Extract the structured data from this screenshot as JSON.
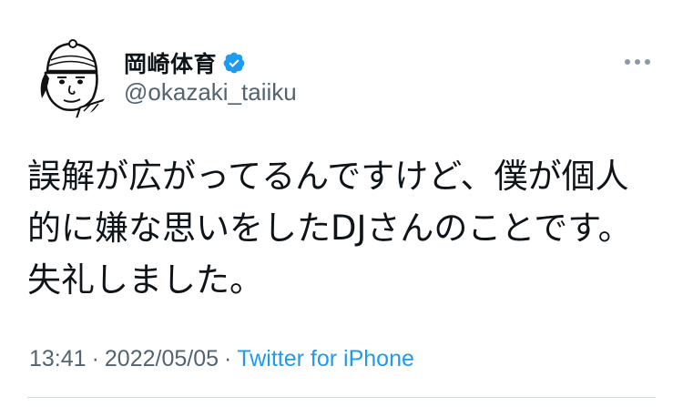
{
  "user": {
    "display_name": "岡崎体育",
    "handle": "@okazaki_taiiku",
    "verified": true,
    "avatar_icon": "profile-avatar-illustration"
  },
  "more_menu": {
    "icon": "more-horizontal-icon"
  },
  "tweet": {
    "text": "誤解が広がってるんですけど、僕が個人的に嫌な思いをしたDJさんのことです。失礼しました。",
    "time": "13:41",
    "separator": "·",
    "date": "2022/05/05",
    "source": "Twitter for iPhone"
  },
  "colors": {
    "text_primary": "#0f1419",
    "text_secondary": "#536471",
    "accent": "#1d9bf0",
    "divider": "#cfd9de"
  }
}
